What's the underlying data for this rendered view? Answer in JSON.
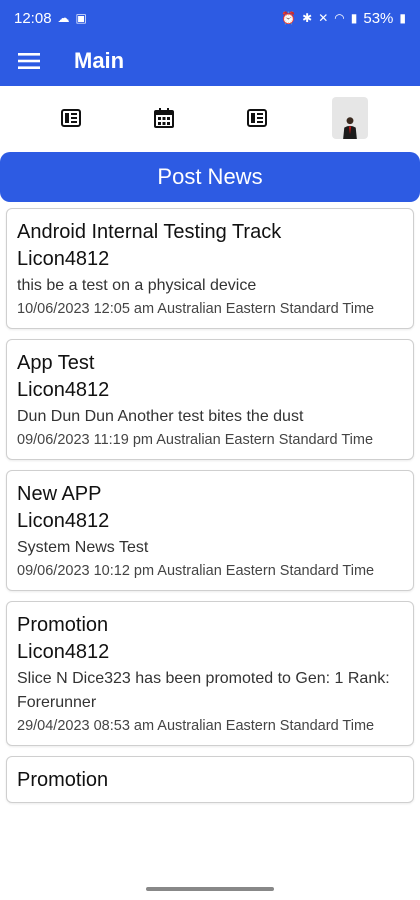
{
  "status_bar": {
    "time": "12:08",
    "battery": "53%",
    "icons_left": [
      "cloud-icon",
      "screen-icon"
    ],
    "icons_right": [
      "alarm-icon",
      "bluetooth-icon",
      "mute-icon",
      "wifi-icon",
      "signal-icon",
      "battery-icon"
    ]
  },
  "app_bar": {
    "title": "Main"
  },
  "toolbar": {
    "items": [
      "news-icon",
      "calendar-icon",
      "news-alt-icon",
      "avatar"
    ]
  },
  "post_button": {
    "label": "Post News"
  },
  "colors": {
    "primary": "#2d5be3"
  },
  "news": [
    {
      "title": "Android Internal Testing Track",
      "author": "Licon4812",
      "body": "this be a test on a physical device",
      "date": "10/06/2023 12:05 am Australian Eastern Standard Time"
    },
    {
      "title": "App Test",
      "author": "Licon4812",
      "body": "Dun Dun Dun Another test bites the dust",
      "date": "09/06/2023 11:19 pm Australian Eastern Standard Time"
    },
    {
      "title": "New APP",
      "author": "Licon4812",
      "body": "System News Test",
      "date": "09/06/2023 10:12 pm Australian Eastern Standard Time"
    },
    {
      "title": "Promotion",
      "author": "Licon4812",
      "body": "Slice N Dice323 has been promoted to  Gen: 1 Rank: Forerunner",
      "date": "29/04/2023 08:53 am Australian Eastern Standard Time"
    },
    {
      "title": "Promotion"
    }
  ]
}
